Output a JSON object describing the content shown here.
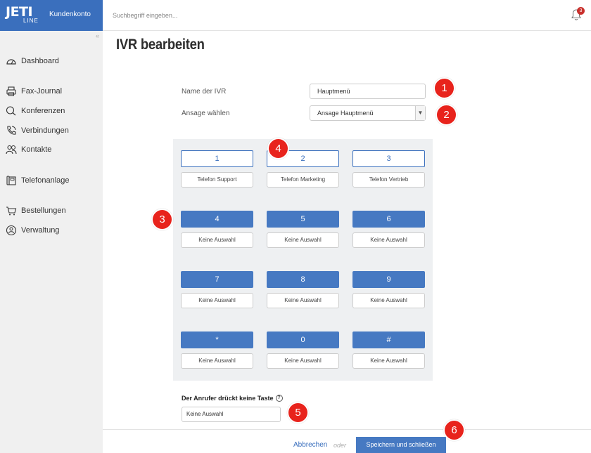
{
  "brand": {
    "logo": "JETI",
    "sub": "LINE",
    "section": "Kundenkonto"
  },
  "search": {
    "placeholder": "Suchbegriff eingeben..."
  },
  "notifications": {
    "count": "3"
  },
  "sidebar": {
    "collapse": "«",
    "items": [
      {
        "label": "Dashboard",
        "icon": "dashboard-icon"
      },
      {
        "label": "Fax-Journal",
        "icon": "fax-icon"
      },
      {
        "label": "Konferenzen",
        "icon": "conference-icon"
      },
      {
        "label": "Verbindungen",
        "icon": "call-icon"
      },
      {
        "label": "Kontakte",
        "icon": "contacts-icon"
      },
      {
        "label": "Telefonanlage",
        "icon": "phone-system-icon"
      },
      {
        "label": "Bestellungen",
        "icon": "cart-icon"
      },
      {
        "label": "Verwaltung",
        "icon": "admin-icon"
      }
    ]
  },
  "main": {
    "title": "IVR bearbeiten",
    "name_label": "Name der IVR",
    "name_value": "Hauptmenü",
    "announcement_label": "Ansage wählen",
    "announcement_value": "Ansage Hauptmenü",
    "keys": [
      {
        "key": "1",
        "target": "Telefon Support",
        "style": "outline"
      },
      {
        "key": "2",
        "target": "Telefon Marketing",
        "style": "outline"
      },
      {
        "key": "3",
        "target": "Telefon Vertrieb",
        "style": "outline"
      },
      {
        "key": "4",
        "target": "Keine Auswahl",
        "style": "filled"
      },
      {
        "key": "5",
        "target": "Keine Auswahl",
        "style": "filled"
      },
      {
        "key": "6",
        "target": "Keine Auswahl",
        "style": "filled"
      },
      {
        "key": "7",
        "target": "Keine Auswahl",
        "style": "filled"
      },
      {
        "key": "8",
        "target": "Keine Auswahl",
        "style": "filled"
      },
      {
        "key": "9",
        "target": "Keine Auswahl",
        "style": "filled"
      },
      {
        "key": "*",
        "target": "Keine Auswahl",
        "style": "filled"
      },
      {
        "key": "0",
        "target": "Keine Auswahl",
        "style": "filled"
      },
      {
        "key": "#",
        "target": "Keine Auswahl",
        "style": "filled"
      }
    ],
    "no_input_label": "Der Anrufer drückt keine Taste",
    "no_input_help": "?",
    "no_input_value": "Keine Auswahl"
  },
  "footer": {
    "cancel": "Abbrechen",
    "or": "oder",
    "save": "Speichern und schließen"
  },
  "markers": [
    "1",
    "2",
    "3",
    "4",
    "5",
    "6"
  ],
  "colors": {
    "brand": "#3a6fbd",
    "key_filled": "#4679c2",
    "marker": "#e8231c",
    "sidebar_bg": "#f0f0f0",
    "keypad_bg": "#eef0f2"
  }
}
